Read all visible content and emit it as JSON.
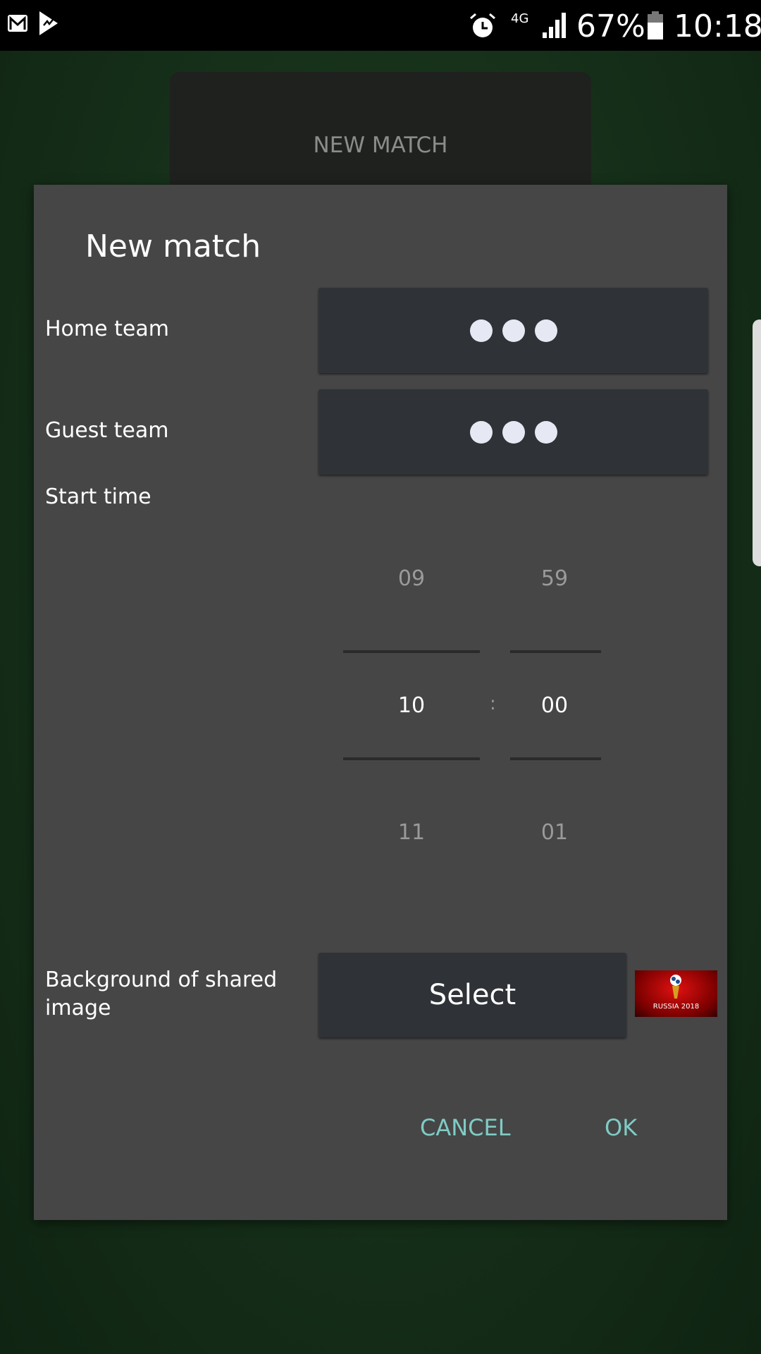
{
  "status_bar": {
    "network": "4G",
    "battery": "67%",
    "time": "10:18",
    "icons": [
      "gmail-icon",
      "app-notification-icon",
      "alarm-icon",
      "signal-icon",
      "battery-icon"
    ]
  },
  "background_card": {
    "label": "NEW MATCH"
  },
  "dialog": {
    "title": "New match",
    "home_label": "Home team",
    "guest_label": "Guest team",
    "start_label": "Start time",
    "time_picker": {
      "hours": [
        "09",
        "10",
        "11"
      ],
      "minutes": [
        "59",
        "00",
        "01"
      ],
      "separator": ":",
      "selected_hour": "10",
      "selected_minute": "00"
    },
    "background_label": "Background of shared image",
    "select_label": "Select",
    "thumbnail_text": "RUSSIA 2018",
    "cancel": "CANCEL",
    "ok": "OK"
  },
  "colors": {
    "accent": "#80cbc4",
    "dialog": "#464646",
    "button": "#2f3236"
  }
}
